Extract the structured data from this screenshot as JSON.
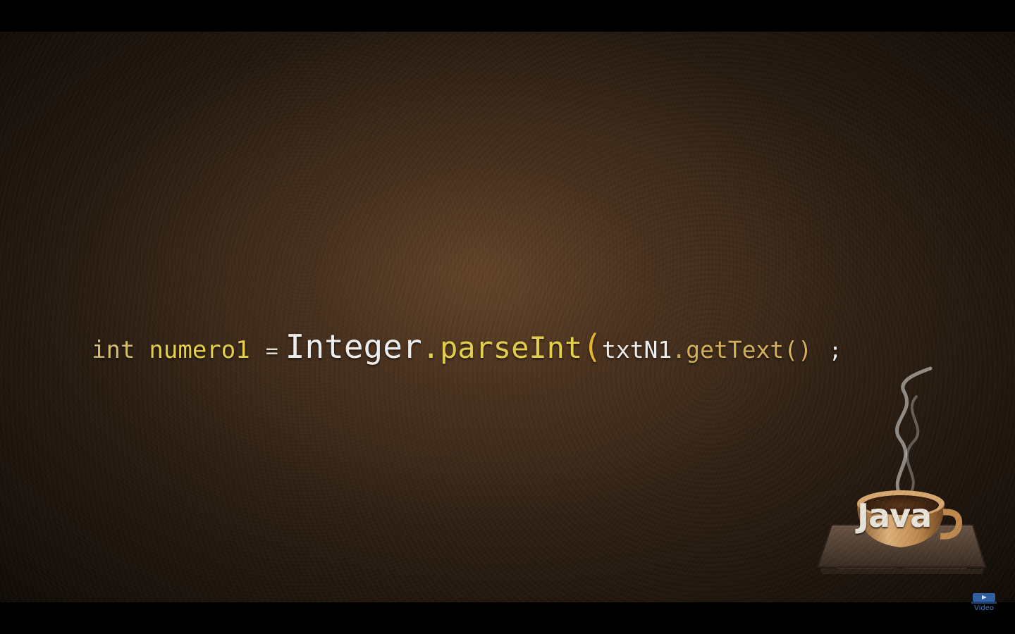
{
  "code": {
    "keyword": "int",
    "variable": "numero1",
    "operator": "=",
    "class_name": "Integer",
    "dot1": ".",
    "method": "parseInt",
    "open_paren": "(",
    "argument": "txtN1",
    "dot2": ".",
    "method_call": "getText()",
    "terminator": ";"
  },
  "logo": {
    "label": "Java",
    "icon": "coffee-cup-icon"
  },
  "watermark": {
    "label": "Video",
    "icon": "video-badge-icon"
  },
  "colors": {
    "keyword": "#d9c070",
    "variable": "#e6d24a",
    "class_name": "#f2f2f2",
    "method": "#e6d24a",
    "paren": "#e6b62e",
    "method_call": "#d6b25a",
    "background": "#352416"
  }
}
